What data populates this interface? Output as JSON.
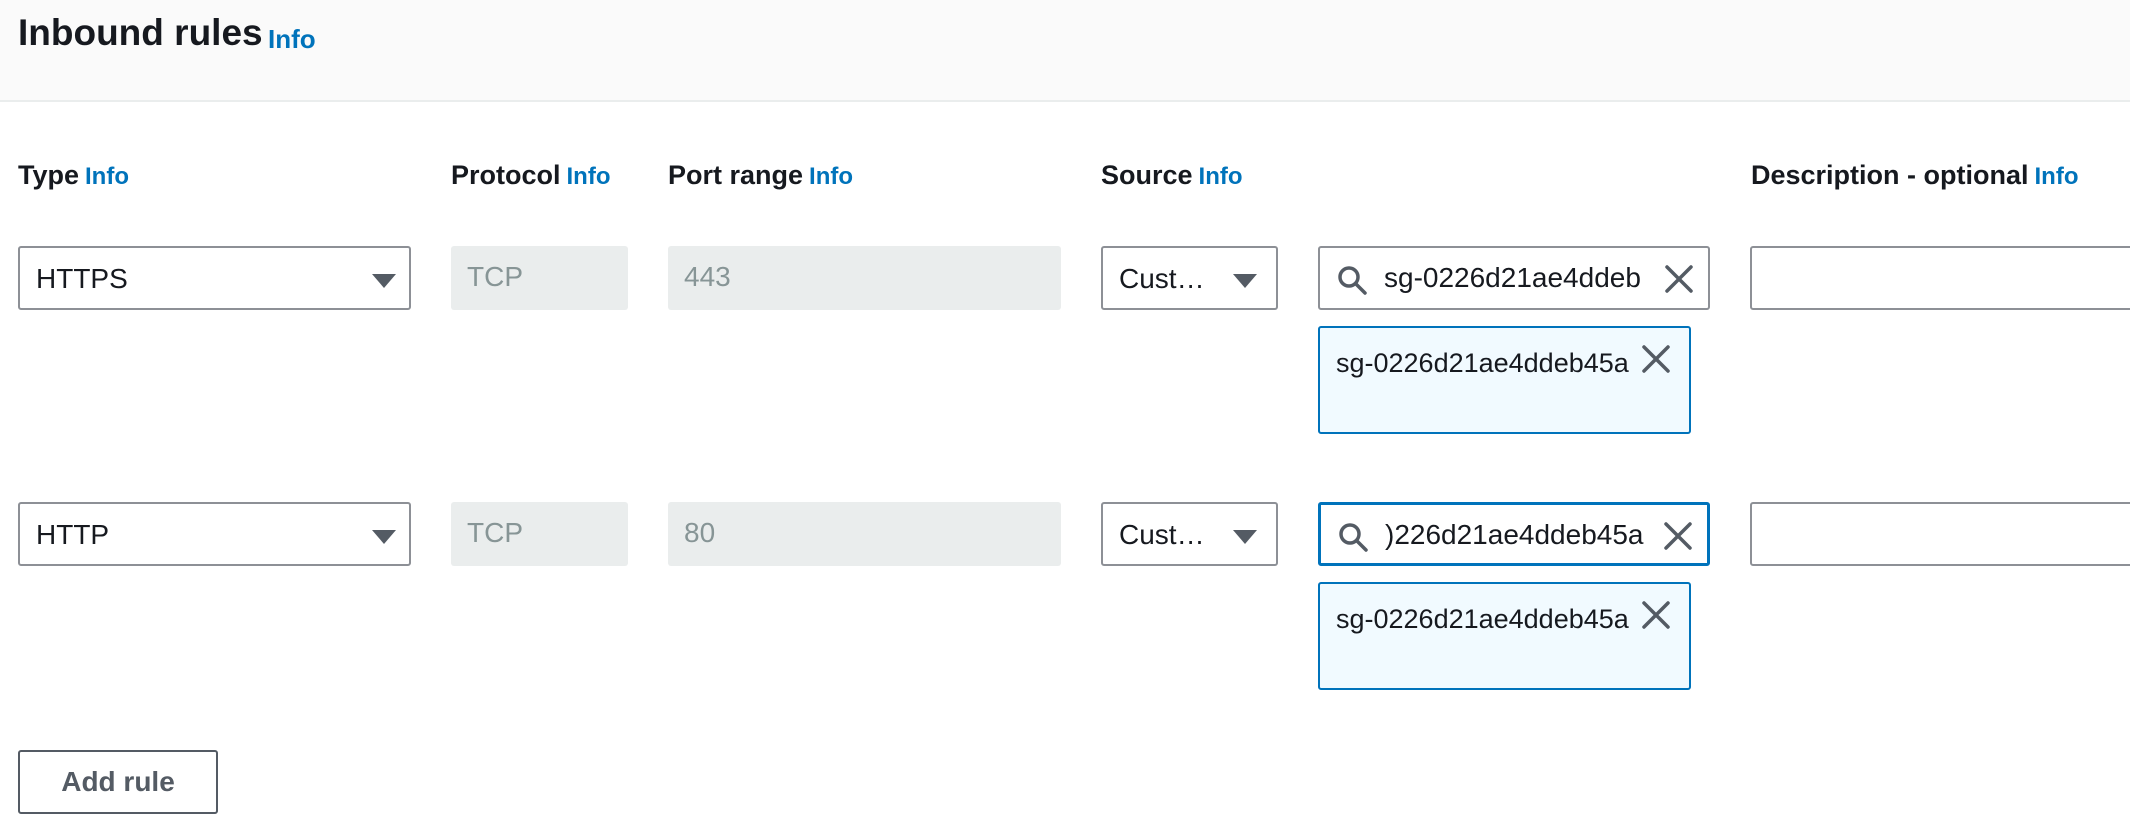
{
  "header": {
    "title": "Inbound rules",
    "info": "Info"
  },
  "columns": {
    "type": {
      "label": "Type",
      "info": "Info"
    },
    "protocol": {
      "label": "Protocol",
      "info": "Info"
    },
    "port_range": {
      "label": "Port range",
      "info": "Info"
    },
    "source": {
      "label": "Source",
      "info": "Info"
    },
    "description": {
      "label": "Description - optional",
      "info": "Info"
    }
  },
  "rules": [
    {
      "type": "HTTPS",
      "protocol": "TCP",
      "port_range": "443",
      "source_type": "Cust…",
      "search_value": "sg-0226d21ae4ddeb",
      "selected_token": "sg-0226d21ae4ddeb45a",
      "description": ""
    },
    {
      "type": "HTTP",
      "protocol": "TCP",
      "port_range": "80",
      "source_type": "Cust…",
      "search_value": ")226d21ae4ddeb45a",
      "selected_token": "sg-0226d21ae4ddeb45a",
      "description": ""
    }
  ],
  "actions": {
    "add_rule": "Add rule"
  },
  "icons": {
    "dropdown": "caret-down-icon",
    "search": "search-icon",
    "clear": "close-icon",
    "remove_token": "close-icon"
  },
  "colors": {
    "link": "#0073bb",
    "focus_border": "#0073bb",
    "token_bg": "#f1faff",
    "disabled_bg": "#eaeded",
    "disabled_text": "#879596"
  }
}
